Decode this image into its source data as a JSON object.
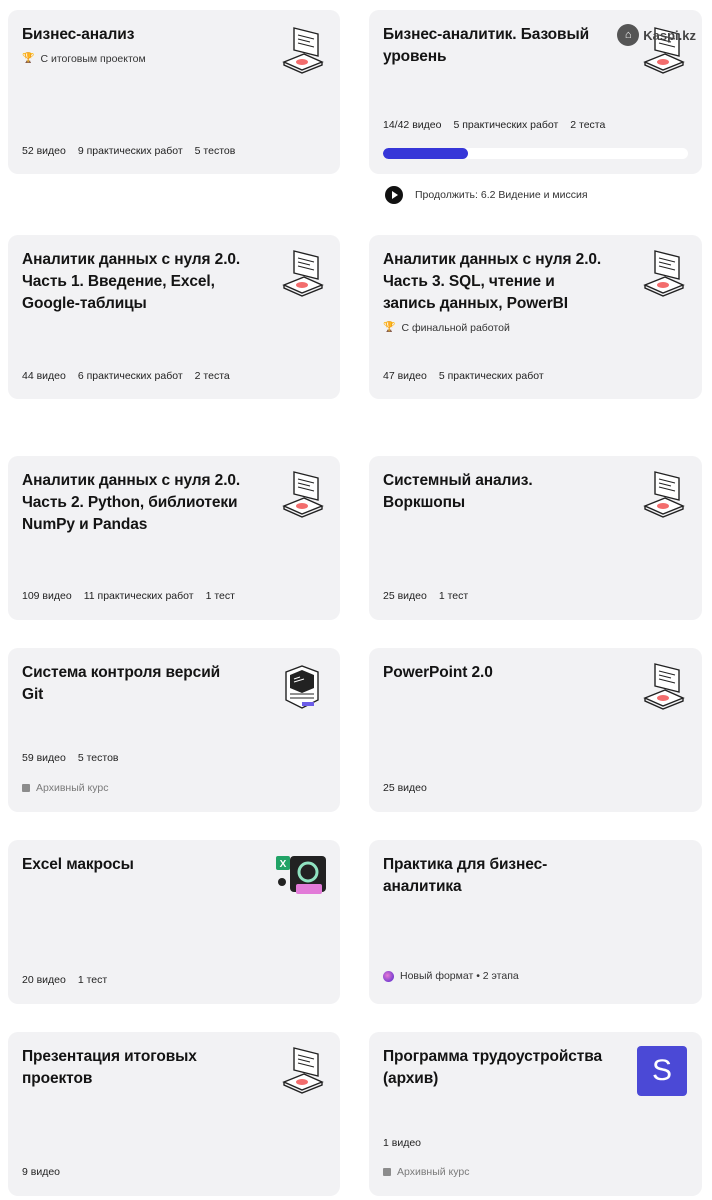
{
  "watermark": "Kaspi.kz",
  "cards": [
    {
      "title_lines": [
        "Бизнес-анализ"
      ],
      "badge": "С итоговым проектом",
      "stats": [
        "52 видео",
        "9 практических работ",
        "5 тестов"
      ]
    },
    {
      "title_lines": [
        "Бизнес-аналитик. Базовый",
        "уровень"
      ],
      "stats": [
        "14/42 видео",
        "5 практических работ",
        "2 теста"
      ],
      "progress_fraction": 0.28,
      "continue_label": "Продолжить: 6.2 Видение и миссия"
    },
    {
      "title_lines": [
        "Аналитик данных с нуля 2.0.",
        "Часть 1. Введение, Excel,",
        "Google-таблицы"
      ],
      "stats": [
        "44 видео",
        "6 практических работ",
        "2 теста"
      ]
    },
    {
      "title_lines": [
        "Аналитик данных с нуля 2.0.",
        "Часть 3. SQL, чтение и",
        "запись данных, PowerBI"
      ],
      "badge": "С финальной работой",
      "stats": [
        "47 видео",
        "5 практических работ"
      ]
    },
    {
      "title_lines": [
        "Аналитик данных с нуля 2.0.",
        "Часть 2. Python, библиотеки",
        "NumPy и Pandas"
      ],
      "stats": [
        "109 видео",
        "11 практических работ",
        "1 тест"
      ]
    },
    {
      "title_lines": [
        "Системный анализ.",
        "Воркшопы"
      ],
      "stats": [
        "25 видео",
        "1 тест"
      ]
    },
    {
      "title_lines": [
        "Система контроля версий",
        "Git"
      ],
      "stats": [
        "59 видео",
        "5 тестов"
      ],
      "archive": "Архивный курс"
    },
    {
      "title_lines": [
        "PowerPoint 2.0"
      ],
      "stats": [
        "25 видео"
      ]
    },
    {
      "title_lines": [
        "Excel макросы"
      ],
      "stats": [
        "20 видео",
        "1 тест"
      ]
    },
    {
      "title_lines": [
        "Практика для бизнес-",
        "аналитика"
      ],
      "format_badge": "Новый формат • 2 этапа"
    },
    {
      "title_lines": [
        "Презентация итоговых",
        "проектов"
      ],
      "stats": [
        "9 видео"
      ]
    },
    {
      "title_lines": [
        "Программа трудоустройства",
        "(архив)"
      ],
      "stats": [
        "1 видео"
      ],
      "archive": "Архивный курс",
      "icon_letter": "S"
    }
  ]
}
